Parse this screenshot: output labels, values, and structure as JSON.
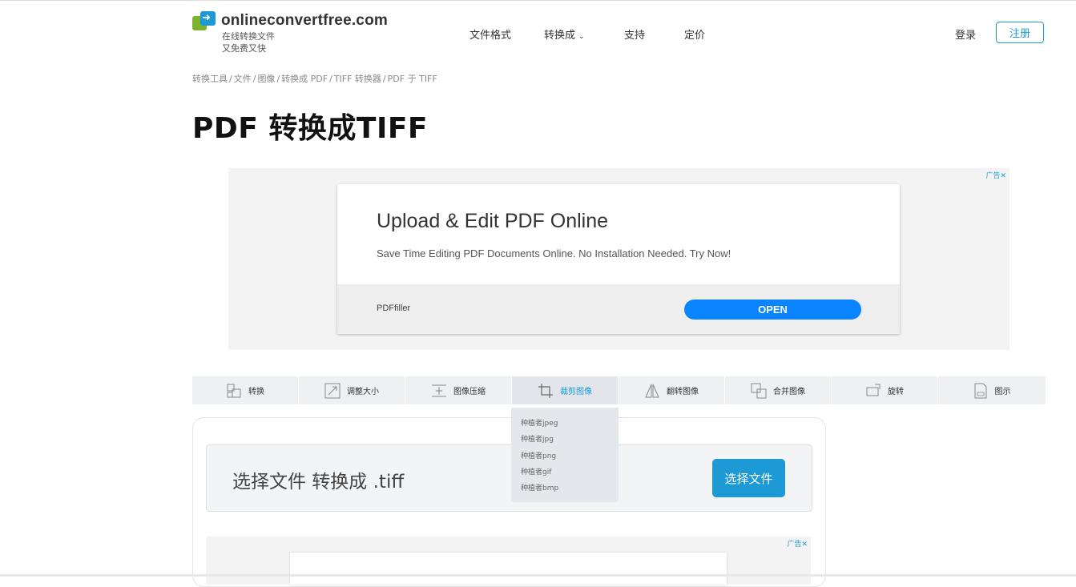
{
  "header": {
    "logo_name": "onlineconvertfree.com",
    "logo_tag_line1": "在线转换文件",
    "logo_tag_line2": "又免费又快",
    "nav": [
      "文件格式",
      "转换成",
      "支持",
      "定价"
    ],
    "login": "登录",
    "register": "注册"
  },
  "breadcrumb": [
    "转换工具",
    "文件",
    "图像",
    "转换成 PDF",
    "TIFF 转换器",
    "PDF 于 TIFF"
  ],
  "page_title": "PDF 转换成TIFF",
  "ad": {
    "label": "广告✕",
    "headline": "Upload & Edit PDF Online",
    "description": "Save Time Editing PDF Documents Online. No Installation Needed. Try Now!",
    "brand": "PDFfiller",
    "cta": "OPEN"
  },
  "toolbar": {
    "tools": [
      "转换",
      "调整大小",
      "图像压缩",
      "裁剪图像",
      "翻转图像",
      "合并图像",
      "旋转",
      "图示"
    ],
    "active_index": 3,
    "dropdown": [
      "种植者jpeg",
      "种植者jpg",
      "种植者png",
      "种植者gif",
      "种植者bmp"
    ]
  },
  "converter": {
    "prompt": "选择文件 转换成 .tiff",
    "button": "选择文件"
  },
  "ad2": {
    "label": "广告✕"
  },
  "colors": {
    "accent": "#1d9ad6",
    "logo_green": "#7cb32a",
    "ad_cta": "#0a84ff"
  }
}
